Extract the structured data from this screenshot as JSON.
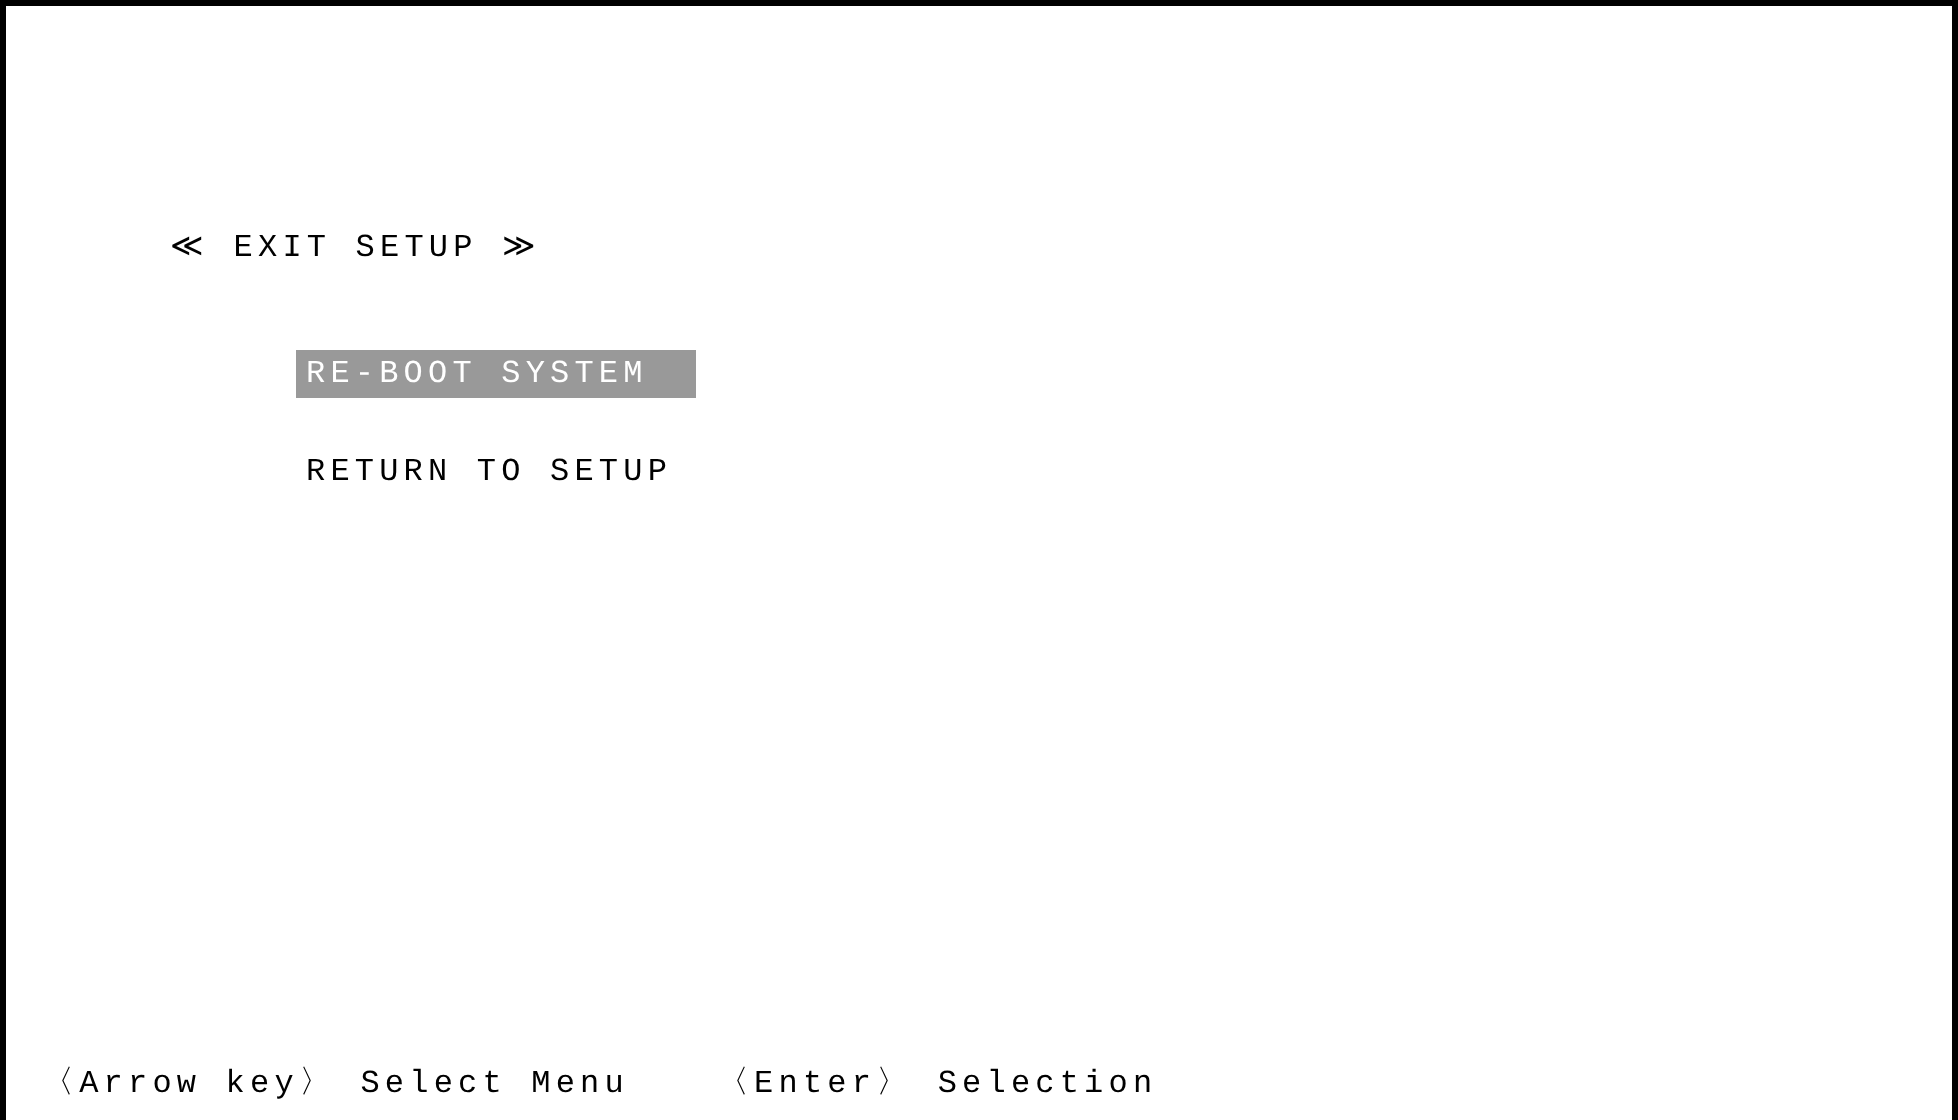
{
  "title": "≪ EXIT SETUP ≫",
  "menu": [
    {
      "label": "RE-BOOT SYSTEM",
      "selected": true
    },
    {
      "label": "RETURN TO SETUP",
      "selected": false
    }
  ],
  "help": [
    "〈Arrow key〉 Select Menu",
    "〈Enter〉 Selection"
  ]
}
